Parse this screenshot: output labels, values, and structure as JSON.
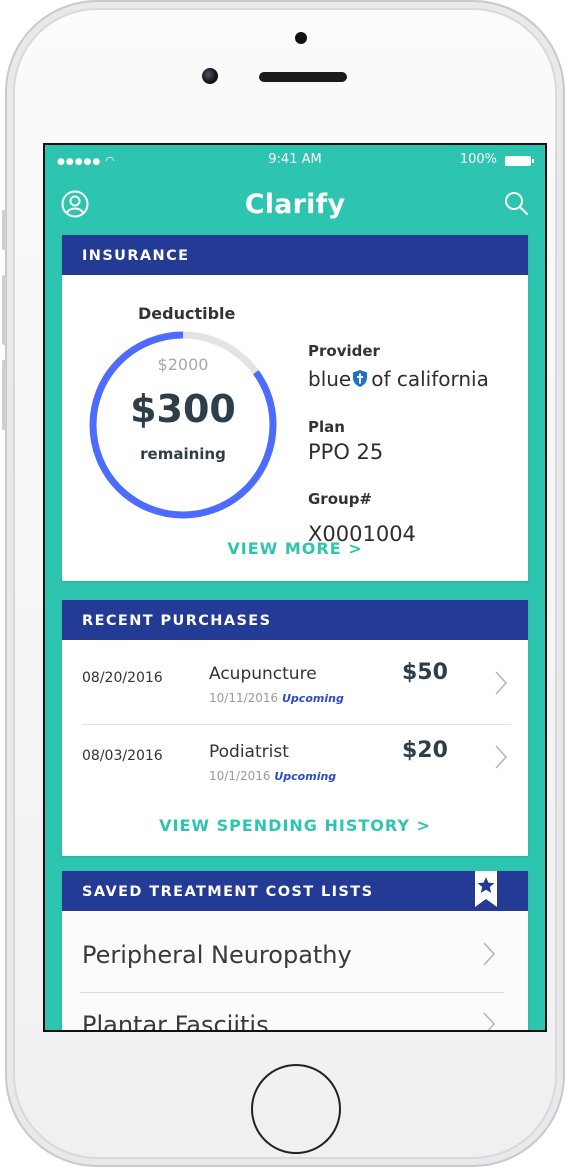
{
  "status_bar": {
    "time": "9:41 AM",
    "battery": "100%"
  },
  "app": {
    "title": "Clarify"
  },
  "insurance": {
    "header": "INSURANCE",
    "deductible_label": "Deductible",
    "deductible_total": "$2000",
    "remaining_amount": "$300",
    "remaining_label": "remaining",
    "remaining_fraction": 0.85,
    "provider_label": "Provider",
    "provider_name_start": "blue",
    "provider_name_end": "of california",
    "plan_label": "Plan",
    "plan_value": "PPO 25",
    "group_label": "Group#",
    "group_value": "X0001004",
    "view_more": "VIEW MORE >"
  },
  "purchases": {
    "header": "RECENT PURCHASES",
    "items": [
      {
        "date": "08/20/2016",
        "name": "Acupuncture",
        "appt_date": "10/11/2016",
        "status": "Upcoming",
        "amount": "$50"
      },
      {
        "date": "08/03/2016",
        "name": "Podiatrist",
        "appt_date": "10/1/2016",
        "status": "Upcoming",
        "amount": "$20"
      }
    ],
    "view_history": "VIEW SPENDING HISTORY >"
  },
  "saved_lists": {
    "header": "SAVED TREATMENT COST LISTS",
    "items": [
      {
        "label": "Peripheral Neuropathy"
      },
      {
        "label": "Plantar Fasciitis"
      }
    ]
  },
  "colors": {
    "teal": "#2ec5b0",
    "navy": "#233b95",
    "ring_blue": "#4d6bff",
    "ring_track": "#e3e3e3",
    "upcoming_blue": "#2a4bc4"
  }
}
